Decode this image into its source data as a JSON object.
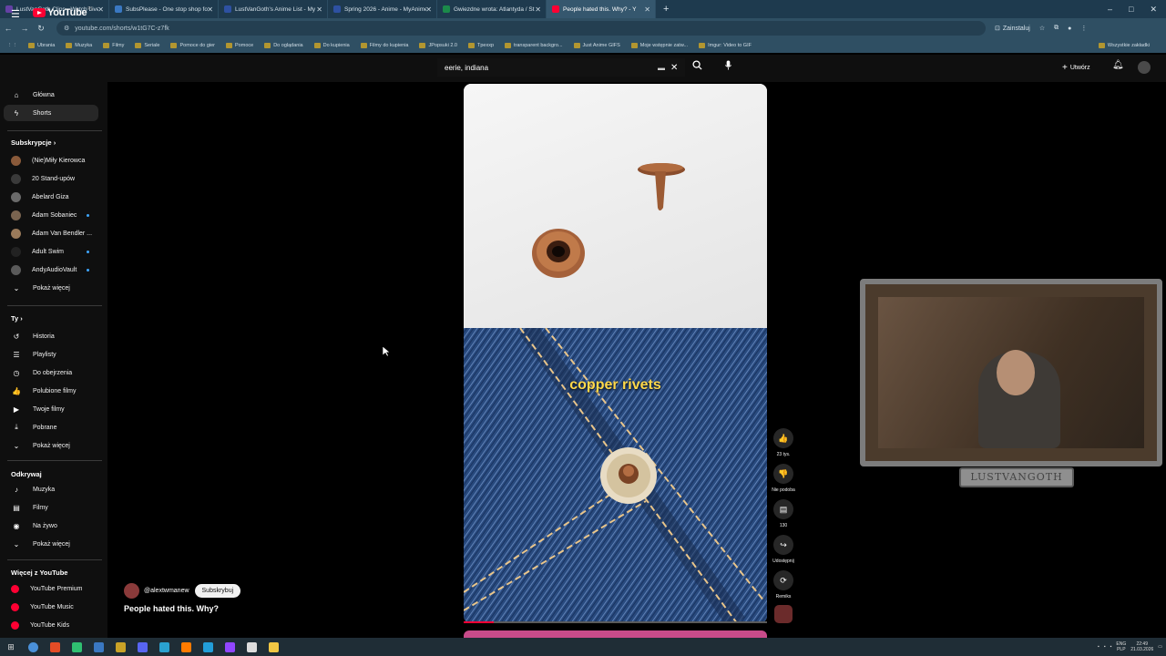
{
  "browser": {
    "tabs": [
      {
        "title": "LustVanGoth Clips - Watch Live",
        "color": "#6441a5"
      },
      {
        "title": "SubsPlease - One stop shop for",
        "color": "#3a78c2"
      },
      {
        "title": "LustVanGoth's Anime List - My",
        "color": "#2e51a2"
      },
      {
        "title": "Spring 2026 - Anime - MyAnime",
        "color": "#2e51a2"
      },
      {
        "title": "Gwiezdne wrota: Atlantyda / St",
        "color": "#1b8a4a"
      },
      {
        "title": "People hated this. Why? - Y",
        "color": "#ff0033"
      }
    ],
    "new_tab": "+",
    "window_controls": [
      "–",
      "□",
      "✕"
    ],
    "url": "youtube.com/shorts/w1tG7C-z7fk",
    "install_label": "Zainstaluj",
    "bookmarks": [
      "Ubrania",
      "Muzyka",
      "Filmy",
      "Seriale",
      "Pomoce do gier",
      "Pomoce",
      "Do oglądania",
      "Do kupienia",
      "Filmy do kupienia",
      "JPopsuki 2.0",
      "Tpexxp",
      "transparent backgro...",
      "Just Anime GIFS",
      "Moje wstępnie zatw...",
      "Imgur: Video to GIF"
    ],
    "bookmarks_right": "Wszystkie zakładki"
  },
  "header": {
    "logo_text": "YouTube",
    "logo_country": "PL",
    "search_value": "eerie, indiana",
    "create_label": "Utwórz"
  },
  "sidebar": {
    "main": [
      {
        "label": "Główna",
        "icon": "⌂"
      },
      {
        "label": "Shorts",
        "icon": "ϟ"
      }
    ],
    "subscriptions_title": "Subskrypcje",
    "subscriptions": [
      {
        "label": "(Nie)Miły Kierowca",
        "color": "#8a5a3a",
        "dot": false
      },
      {
        "label": "20 Stand-upów",
        "color": "#3a3a3a",
        "dot": false
      },
      {
        "label": "Abelard Giza",
        "color": "#6a6a6a",
        "dot": false
      },
      {
        "label": "Adam Sobaniec",
        "color": "#7a6450",
        "dot": true
      },
      {
        "label": "Adam Van Bendler ...",
        "color": "#9a7a5a",
        "dot": false
      },
      {
        "label": "Adult Swim",
        "color": "#222222",
        "dot": true
      },
      {
        "label": "AndyAudioVault",
        "color": "#5a5a5a",
        "dot": true
      }
    ],
    "show_more": "Pokaż więcej",
    "you_title": "Ty",
    "you": [
      {
        "label": "Historia",
        "icon": "↺"
      },
      {
        "label": "Playlisty",
        "icon": "☰"
      },
      {
        "label": "Do obejrzenia",
        "icon": "◷"
      },
      {
        "label": "Polubione filmy",
        "icon": "👍"
      },
      {
        "label": "Twoje filmy",
        "icon": "▶"
      },
      {
        "label": "Pobrane",
        "icon": "⤓"
      },
      {
        "label": "Pokaż więcej",
        "icon": "⌄"
      }
    ],
    "explore_title": "Odkrywaj",
    "explore": [
      {
        "label": "Muzyka",
        "icon": "♪"
      },
      {
        "label": "Filmy",
        "icon": "▤"
      },
      {
        "label": "Na żywo",
        "icon": "◉"
      },
      {
        "label": "Pokaż więcej",
        "icon": "⌄"
      }
    ],
    "more_title": "Więcej z YouTube",
    "more": [
      {
        "label": "YouTube Premium",
        "color": "#ff0033"
      },
      {
        "label": "YouTube Music",
        "color": "#ff0033"
      },
      {
        "label": "YouTube Kids",
        "color": "#ff0033"
      }
    ]
  },
  "short": {
    "caption": "copper rivets",
    "progress_fraction": 0.1,
    "channel": "@alextwmanew",
    "subscribe_label": "Subskrybuj",
    "title": "People hated this. Why?"
  },
  "actions": [
    {
      "icon": "👍",
      "label": "23 tys.",
      "name": "like"
    },
    {
      "icon": "👎",
      "label": "Nie podoba",
      "name": "dislike"
    },
    {
      "icon": "▤",
      "label": "130",
      "name": "comments"
    },
    {
      "icon": "↪",
      "label": "Udostępnij",
      "name": "share"
    },
    {
      "icon": "⟳",
      "label": "Remiks",
      "name": "remix"
    }
  ],
  "stream_overlay": {
    "name_plate": "LUSTVANGOTH"
  },
  "taskbar": {
    "apps": [
      {
        "color": "#4a90d9"
      },
      {
        "color": "#e34c26"
      },
      {
        "color": "#2fbf71"
      },
      {
        "color": "#3a78c2"
      },
      {
        "color": "#c9a227"
      },
      {
        "color": "#5865f2"
      },
      {
        "color": "#2aa1d0"
      },
      {
        "color": "#ff7b00"
      },
      {
        "color": "#229ed9"
      },
      {
        "color": "#9146ff"
      },
      {
        "color": "#dddddd"
      },
      {
        "color": "#f2c744"
      }
    ],
    "lang_top": "ENG",
    "lang_bottom": "PLP",
    "time": "22:49",
    "date": "21.03.2026"
  }
}
